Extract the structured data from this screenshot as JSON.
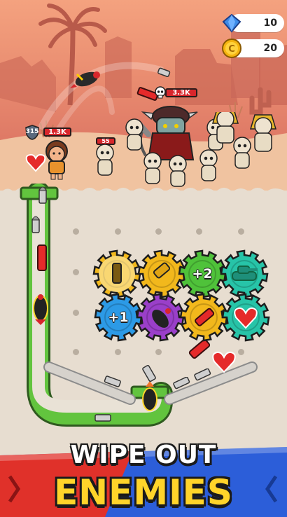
{
  "currency": {
    "gems": "10",
    "coins": "20",
    "coin_symbol": "C"
  },
  "battle": {
    "hero_shield": "315",
    "hero_hp": "1.3K",
    "boss_hp": "3.3K",
    "minion_hp": "55"
  },
  "gears": [
    {
      "id": "bullet",
      "label": "",
      "color": "#f2b81c"
    },
    {
      "id": "bullet-star",
      "label": "",
      "color": "#f2b81c"
    },
    {
      "id": "plus-two",
      "label": "+2",
      "color": "#4fc23a"
    },
    {
      "id": "tank",
      "label": "",
      "color": "#27c4a8"
    },
    {
      "id": "plus-one",
      "label": "+1",
      "color": "#2c9ae6"
    },
    {
      "id": "bomb",
      "label": "",
      "color": "#9a3fc9"
    },
    {
      "id": "dynamite",
      "label": "",
      "color": "#f2b81c"
    },
    {
      "id": "heart",
      "label": "",
      "color": "#27c4a8"
    }
  ],
  "banner": {
    "line1": "WIPE OUT",
    "line2": "ENEMIES"
  },
  "colors": {
    "accent_yellow": "#ffd42a",
    "pipe_green": "#5cc23d",
    "hp_red": "#d8262c"
  }
}
